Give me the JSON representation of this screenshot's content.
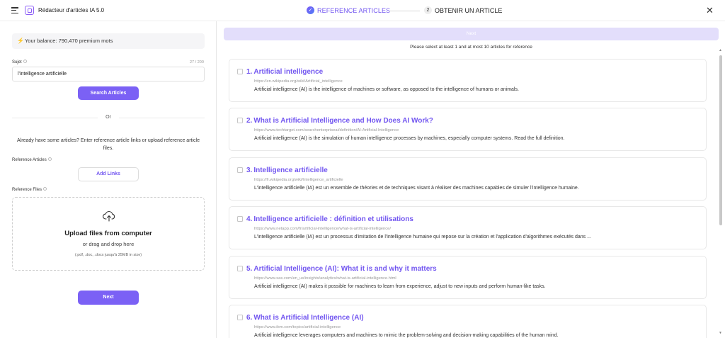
{
  "header": {
    "app_title": "Rédacteur d'articles IA 5.0",
    "step1_label": "REFERENCE ARTICLES",
    "step2_number": "2",
    "step2_label": "OBTENIR UN ARTICLE",
    "close_symbol": "✕",
    "menu_icon": "hamburger-icon",
    "logo_icon": "app-logo-icon"
  },
  "left": {
    "balance_text": "Your balance: 790,470 premium mots",
    "subject_label": "Sujet",
    "subject_counter": "27 / 200",
    "subject_value": "l'intelligence artificielle",
    "search_button": "Search Articles",
    "or_text": "Or",
    "already_text": "Already have some articles? Enter reference article links or upload reference article files.",
    "ref_articles_label": "Reference Articles",
    "add_links_button": "Add Links",
    "ref_files_label": "Reference Files",
    "upload_title": "Upload files from computer",
    "upload_sub": "or drag and drop here",
    "upload_hint": "(.pdf, .doc, .docx jusqu'à 25MB in size)",
    "next_button": "Next"
  },
  "right": {
    "next_button": "Next",
    "hint": "Please select at least 1 and at most 10 articles for reference",
    "articles": [
      {
        "num": "1.",
        "title": "Artificial intelligence",
        "url": "https://en.wikipedia.org/wiki/Artificial_intelligence",
        "desc": "Artificial intelligence (AI) is the intelligence of machines or software, as opposed to the intelligence of humans or animals."
      },
      {
        "num": "2.",
        "title": "What is Artificial Intelligence and How Does AI Work?",
        "url": "https://www.techtarget.com/searchenterpriseai/definition/AI-Artificial-Intelligence",
        "desc": "Artificial intelligence (AI) is the simulation of human intelligence processes by machines, especially computer systems. Read the full definition."
      },
      {
        "num": "3.",
        "title": "Intelligence artificielle",
        "url": "https://fr.wikipedia.org/wiki/Intelligence_artificielle",
        "desc": "L'intelligence artificielle (IA) est un ensemble de théories et de techniques visant à réaliser des machines capables de simuler l'intelligence humaine."
      },
      {
        "num": "4.",
        "title": "Intelligence artificielle : définition et utilisations",
        "url": "https://www.netapp.com/fr/artificial-intelligence/what-is-artificial-intelligence/",
        "desc": "L'intelligence artificielle (IA) est un processus d'imitation de l'intelligence humaine qui repose sur la création et l'application d'algorithmes exécutés dans ..."
      },
      {
        "num": "5.",
        "title": "Artificial Intelligence (AI): What it is and why it matters",
        "url": "https://www.sas.com/en_us/insights/analytics/what-is-artificial-intelligence.html",
        "desc": "Artificial intelligence (AI) makes it possible for machines to learn from experience, adjust to new inputs and perform human-like tasks."
      },
      {
        "num": "6.",
        "title": "What is Artificial Intelligence (AI)",
        "url": "https://www.ibm.com/topics/artificial-intelligence",
        "desc": "Artificial intelligence leverages computers and machines to mimic the problem-solving and decision-making capabilities of the human mind."
      }
    ]
  },
  "colors": {
    "accent": "#7b61f5",
    "accent_text": "#7256f0",
    "disabled_button": "#e3defb"
  }
}
